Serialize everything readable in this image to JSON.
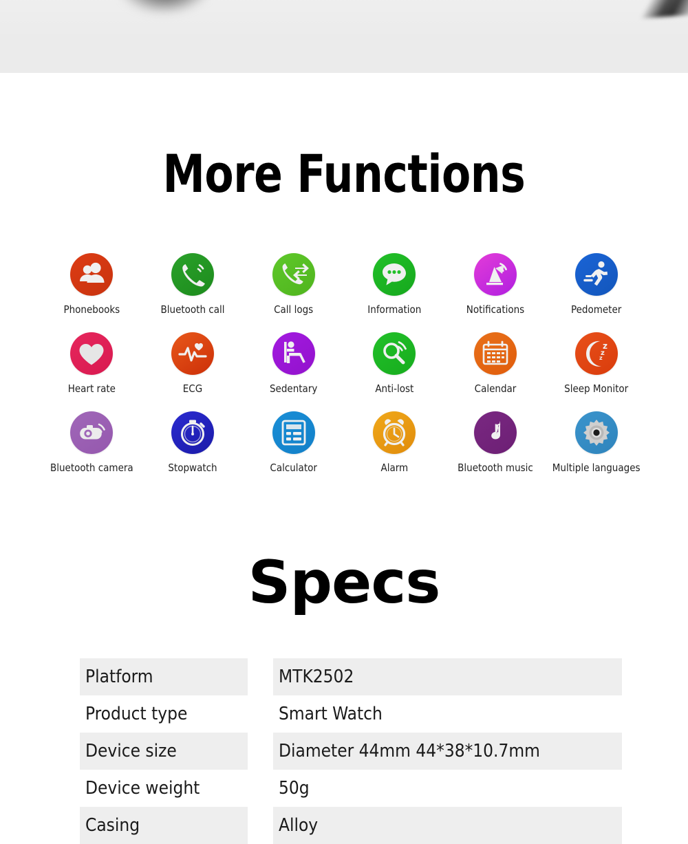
{
  "banner": {
    "background_color": "#ebebeb",
    "description": "product-photo-bottom-edge"
  },
  "headings": {
    "more_functions": "More Functions",
    "specs": "Specs"
  },
  "features": [
    {
      "label": "Phonebooks",
      "icon": "contacts-icon",
      "color": "#dd3c14",
      "color2": "#c8330f",
      "glyph": "contacts"
    },
    {
      "label": "Bluetooth call",
      "icon": "phone-call-icon",
      "color": "#2aa12a",
      "color2": "#1d8b1d",
      "glyph": "phone"
    },
    {
      "label": "Call logs",
      "icon": "call-logs-icon",
      "color": "#5fc82a",
      "color2": "#4fb41e",
      "glyph": "calllog"
    },
    {
      "label": "Information",
      "icon": "chat-bubble-icon",
      "color": "#22c029",
      "color2": "#16a81d",
      "glyph": "chat"
    },
    {
      "label": "Notifications",
      "icon": "satellite-dish-icon",
      "color": "#e33cd8",
      "color2": "#b01fe0",
      "glyph": "dish"
    },
    {
      "label": "Pedometer",
      "icon": "running-person-icon",
      "color": "#1a64d6",
      "color2": "#1356bb",
      "glyph": "run"
    },
    {
      "label": "Heart rate",
      "icon": "heart-icon",
      "color": "#e6265c",
      "color2": "#d81a50",
      "glyph": "heart"
    },
    {
      "label": "ECG",
      "icon": "ecg-waveform-icon",
      "color": "#e8581a",
      "color2": "#cc2f08",
      "glyph": "ecg"
    },
    {
      "label": "Sedentary",
      "icon": "sitting-person-icon",
      "color": "#a31ae0",
      "color2": "#9212cc",
      "glyph": "sit"
    },
    {
      "label": "Anti-lost",
      "icon": "magnifier-signal-icon",
      "color": "#22c029",
      "color2": "#17ac1e",
      "glyph": "antilost"
    },
    {
      "label": "Calendar",
      "icon": "calendar-icon",
      "color": "#e8701a",
      "color2": "#e05d0c",
      "glyph": "calendar"
    },
    {
      "label": "Sleep Monitor",
      "icon": "moon-zzz-icon",
      "color": "#e8501a",
      "color2": "#d93c0c",
      "glyph": "sleep"
    },
    {
      "label": "Bluetooth camera",
      "icon": "camera-signal-icon",
      "color": "#a067b8",
      "color2": "#9558ae",
      "glyph": "camera"
    },
    {
      "label": "Stopwatch",
      "icon": "stopwatch-icon",
      "color": "#2b2bd0",
      "color2": "#1a1aa8",
      "glyph": "stopwatch"
    },
    {
      "label": "Calculator",
      "icon": "calculator-icon",
      "color": "#1a8ed6",
      "color2": "#1280c8",
      "glyph": "calculator"
    },
    {
      "label": "Alarm",
      "icon": "alarm-clock-icon",
      "color": "#f0a81a",
      "color2": "#e08c0c",
      "glyph": "alarm"
    },
    {
      "label": "Bluetooth music",
      "icon": "music-note-icon",
      "color": "#7a2882",
      "color2": "#6c1f74",
      "glyph": "music"
    },
    {
      "label": "Multiple languages",
      "icon": "gear-icon",
      "color": "#3b94cc",
      "color2": "#2f84bc",
      "glyph": "gear"
    }
  ],
  "specs_table": {
    "rows": [
      {
        "key": "Platform",
        "value": "MTK2502",
        "shaded": true
      },
      {
        "key": "Product type",
        "value": "Smart Watch",
        "shaded": false
      },
      {
        "key": "Device size",
        "value": "Diameter 44mm  44*38*10.7mm",
        "shaded": true
      },
      {
        "key": "Device weight",
        "value": "50g",
        "shaded": false
      },
      {
        "key": "Casing",
        "value": "Alloy",
        "shaded": true
      }
    ]
  }
}
